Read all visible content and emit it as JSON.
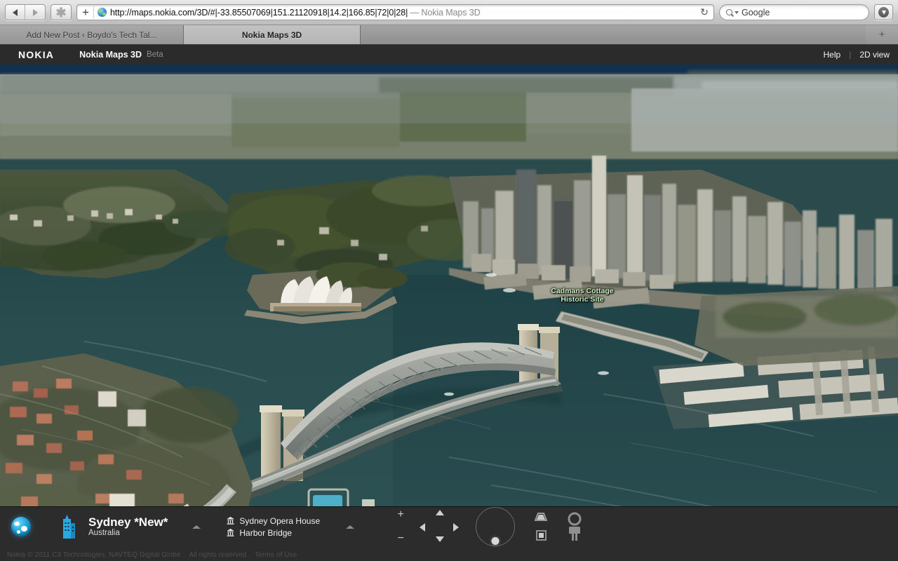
{
  "browser": {
    "nav": {
      "back_label": "Back",
      "forward_label": "Forward",
      "bookmark_label": "✱"
    },
    "address": {
      "add_label": "+",
      "url": "http://maps.nokia.com/3D/#|-33.85507069|151.21120918|14.2|166.85|72|0|28|",
      "page_title_suffix": " — Nokia Maps 3D",
      "reload_glyph": "↻"
    },
    "search": {
      "value": "Google",
      "placeholder": "Google",
      "engine_icon": "search-icon"
    },
    "downloads_label": "Downloads",
    "tabs": [
      {
        "label": "Add New Post ‹ Boydo's Tech Tal...",
        "active": false
      },
      {
        "label": "Nokia Maps 3D",
        "active": true
      }
    ],
    "new_tab_label": "+"
  },
  "app": {
    "brand": "NOKIA",
    "title": "Nokia Maps 3D",
    "beta_badge": "Beta",
    "help_label": "Help",
    "separator": "|",
    "view_toggle_label": "2D view"
  },
  "map": {
    "labels": [
      {
        "text": "Cadmans Cottage Historic Site",
        "color": "#c6efbc"
      }
    ],
    "water_color": "#2a4a4c",
    "sky_color": "#1d3d63"
  },
  "bottom_bar": {
    "globe_icon": "globe-icon",
    "city_icon": "city-buildings-icon",
    "place_name": "Sydney *New*",
    "place_country": "Australia",
    "collapse_glyph": "▲",
    "landmarks": [
      {
        "name": "Sydney Opera House",
        "icon": "monument-icon"
      },
      {
        "name": "Harbor Bridge",
        "icon": "monument-icon"
      }
    ],
    "controls": {
      "zoom_in": "+",
      "zoom_out": "−",
      "pan_up": "∧",
      "pan_down": "∨",
      "pan_left": "‹",
      "pan_right": "›",
      "tilt_label": "Tilt",
      "view_perspective_label": "Perspective view",
      "view_topdown_label": "Top-down view",
      "streetlevel_label": "Street level"
    },
    "copyright": {
      "main": "Nokia © 2011 C3 Technologies, NAVTEQ Digital Globe",
      "rights": "All rights reserved",
      "terms": "Terms of Use"
    }
  }
}
